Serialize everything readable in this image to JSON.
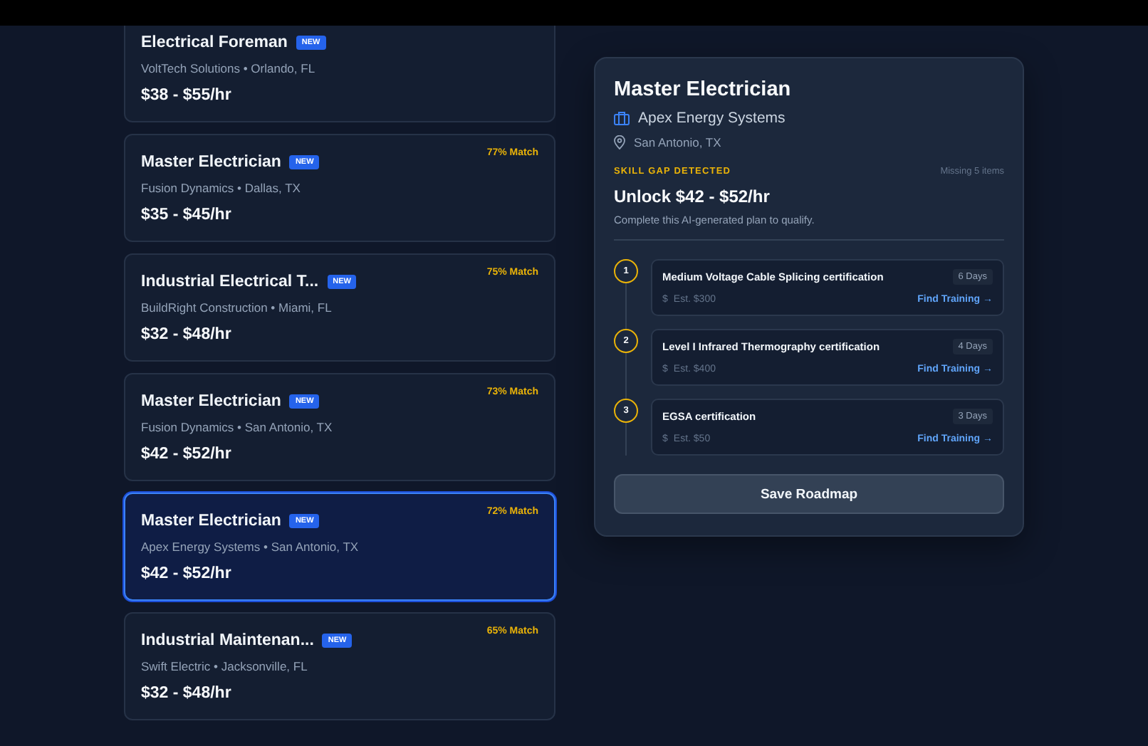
{
  "jobs": [
    {
      "title": "Electrical Foreman",
      "badge": "NEW",
      "meta": "VoltTech Solutions • Orlando, FL",
      "pay": "$38 - $55/hr",
      "selected": false
    },
    {
      "title": "Master Electrician",
      "badge": "NEW",
      "meta": "Fusion Dynamics • Dallas, TX",
      "pay": "$35 - $45/hr",
      "match": "77% Match",
      "selected": false
    },
    {
      "title": "Industrial Electrical T...",
      "badge": "NEW",
      "meta": "BuildRight Construction • Miami, FL",
      "pay": "$32 - $48/hr",
      "match": "75% Match",
      "selected": false
    },
    {
      "title": "Master Electrician",
      "badge": "NEW",
      "meta": "Fusion Dynamics • San Antonio, TX",
      "pay": "$42 - $52/hr",
      "match": "73% Match",
      "selected": false
    },
    {
      "title": "Master Electrician",
      "badge": "NEW",
      "meta": "Apex Energy Systems • San Antonio, TX",
      "pay": "$42 - $52/hr",
      "match": "72% Match",
      "selected": true
    },
    {
      "title": "Industrial Maintenan...",
      "badge": "NEW",
      "meta": "Swift Electric • Jacksonville, FL",
      "pay": "$32 - $48/hr",
      "match": "65% Match",
      "selected": false
    }
  ],
  "detail": {
    "title": "Master Electrician",
    "company": "Apex Energy Systems",
    "location": "San Antonio, TX",
    "gap_label": "SKILL GAP DETECTED",
    "missing": "Missing 5 items",
    "unlock": "Unlock $42 - $52/hr",
    "subtitle": "Complete this AI-generated plan to qualify.",
    "steps": [
      {
        "number": "1",
        "name": "Medium Voltage Cable Splicing certification",
        "duration": "6 Days",
        "cost": "Est. $300",
        "currency": "$",
        "link": "Find Training →"
      },
      {
        "number": "2",
        "name": "Level I Infrared Thermography certification",
        "duration": "4 Days",
        "cost": "Est. $400",
        "currency": "$",
        "link": "Find Training →"
      },
      {
        "number": "3",
        "name": "EGSA certification",
        "duration": "3 Days",
        "cost": "Est. $50",
        "currency": "$",
        "link": "Find Training →"
      }
    ],
    "button": "Save Roadmap"
  }
}
